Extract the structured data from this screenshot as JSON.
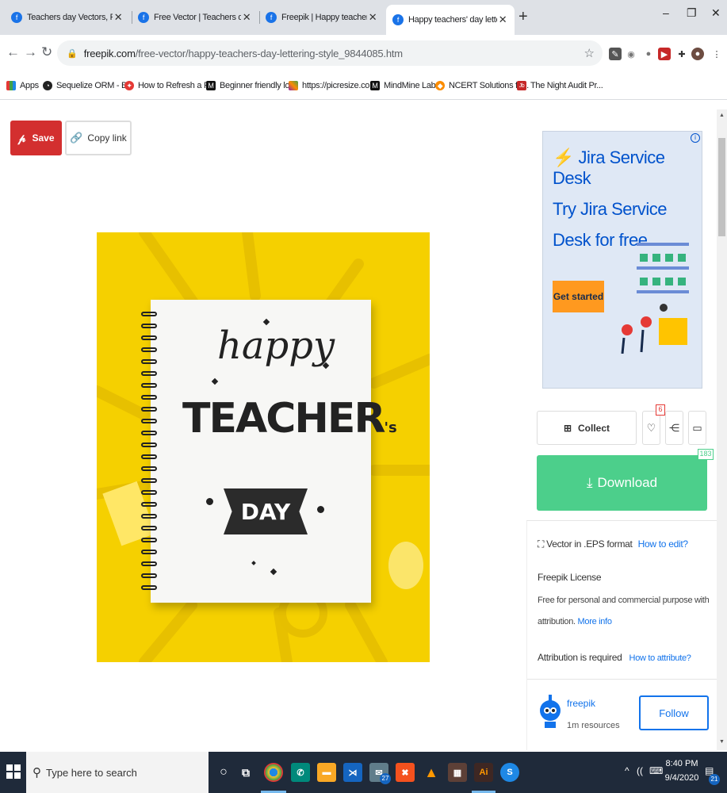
{
  "tabs": [
    {
      "title": "Teachers day Vectors, Photos and"
    },
    {
      "title": "Free Vector | Teachers day illustra"
    },
    {
      "title": "Freepik | Happy teachers' day lett"
    },
    {
      "title": "Happy teachers' day lettering sty"
    }
  ],
  "browser": {
    "url_domain": "freepik.com",
    "url_path": "/free-vector/happy-teachers-day-lettering-style_9844085.htm"
  },
  "bookmarks": [
    {
      "label": "Apps",
      "icon": "apps-grid-icon"
    },
    {
      "label": "Sequelize ORM - B...",
      "icon": "sequelize-icon"
    },
    {
      "label": "How to Refresh a P...",
      "icon": "refresh-site-icon"
    },
    {
      "label": "Beginner friendly lo...",
      "icon": "medium-icon"
    },
    {
      "label": "https://picresize.co...",
      "icon": "picresize-icon"
    },
    {
      "label": "MindMine Labs",
      "icon": "medium-icon"
    },
    {
      "label": "NCERT Solutions fo...",
      "icon": "ncert-icon"
    },
    {
      "label": "The Night Audit Pr...",
      "icon": "job-icon"
    }
  ],
  "actions": {
    "save_label": "Save",
    "copy_label": "Copy link"
  },
  "artwork": {
    "line1": "happy",
    "line2": "TEACHER",
    "line2_suffix": "'s",
    "line3": "DAY"
  },
  "ad": {
    "brand": "Jira Service Desk",
    "headline": "Try Jira Service Desk for free",
    "cta": "Get started"
  },
  "sidebar": {
    "collect_label": "Collect",
    "like_count": "6",
    "download_label": "Download",
    "download_count": "183",
    "format_text": "Vector in .EPS format",
    "how_to_edit": "How to edit?",
    "license_title": "Freepik License",
    "license_text_1": "Free for personal and commercial purpose with",
    "license_text_2": "attribution.",
    "more_info": "More info",
    "attribution_text": "Attribution is required",
    "how_to_attribute": "How to attribute?",
    "author_name": "freepik",
    "author_resources": "1m resources",
    "follow_label": "Follow"
  },
  "taskbar": {
    "search_placeholder": "Type here to search",
    "time": "8:40 PM",
    "date": "9/4/2020",
    "mail_badge": "27",
    "notif_count": "21"
  },
  "colors": {
    "save_red": "#d32f2f",
    "download_green": "#4ccf8b",
    "link_blue": "#1273eb",
    "art_yellow": "#f5d000"
  }
}
